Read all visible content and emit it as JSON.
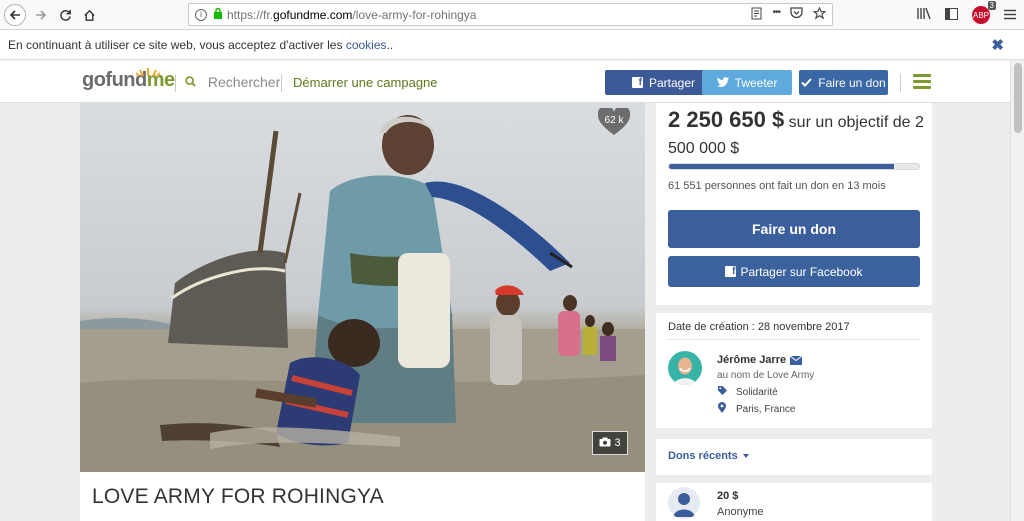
{
  "browser": {
    "url_prefix": "https://fr.",
    "url_domain": "gofundme.com",
    "url_path": "/love-army-for-rohingya",
    "more_dots": "•••",
    "adblock_label": "ABP",
    "adblock_count": "3"
  },
  "cookie": {
    "text": "En continuant à utiliser ce site web, vous acceptez d'activer les ",
    "link": "cookies",
    "suffix": ".."
  },
  "header": {
    "logo_go": "gofund",
    "logo_me": "me",
    "search_label": "Rechercher",
    "start_label": "Démarrer une campagne",
    "share_label": "Partager",
    "tweet_label": "Tweeter",
    "donate_label": "Faire un don"
  },
  "photo": {
    "hearts": "62 k",
    "photo_count": "3"
  },
  "campaign": {
    "title": "LOVE ARMY FOR ROHINGYA",
    "amount": "2 250 650 $",
    "goal_text": " sur un objectif de 2 500 000 $",
    "progress_fraction": 0.9,
    "stats": "61 551 personnes ont fait un don en 13 mois",
    "donate_button": "Faire un don",
    "fb_button": "Partager sur Facebook"
  },
  "info": {
    "created": "Date de création : 28 novembre 2017",
    "organizer": "Jérôme Jarre",
    "behalf": "au nom de Love Army",
    "category": "Solidarité",
    "location": "Paris, France"
  },
  "dons": {
    "title": "Dons récents",
    "first_amount": "20 $",
    "first_name": "Anonyme"
  },
  "colors": {
    "brand_green": "#7e9a2f",
    "facebook_blue": "#3d5a98",
    "twitter_blue": "#5ea9dd",
    "donate_blue": "#3b5f9c"
  }
}
